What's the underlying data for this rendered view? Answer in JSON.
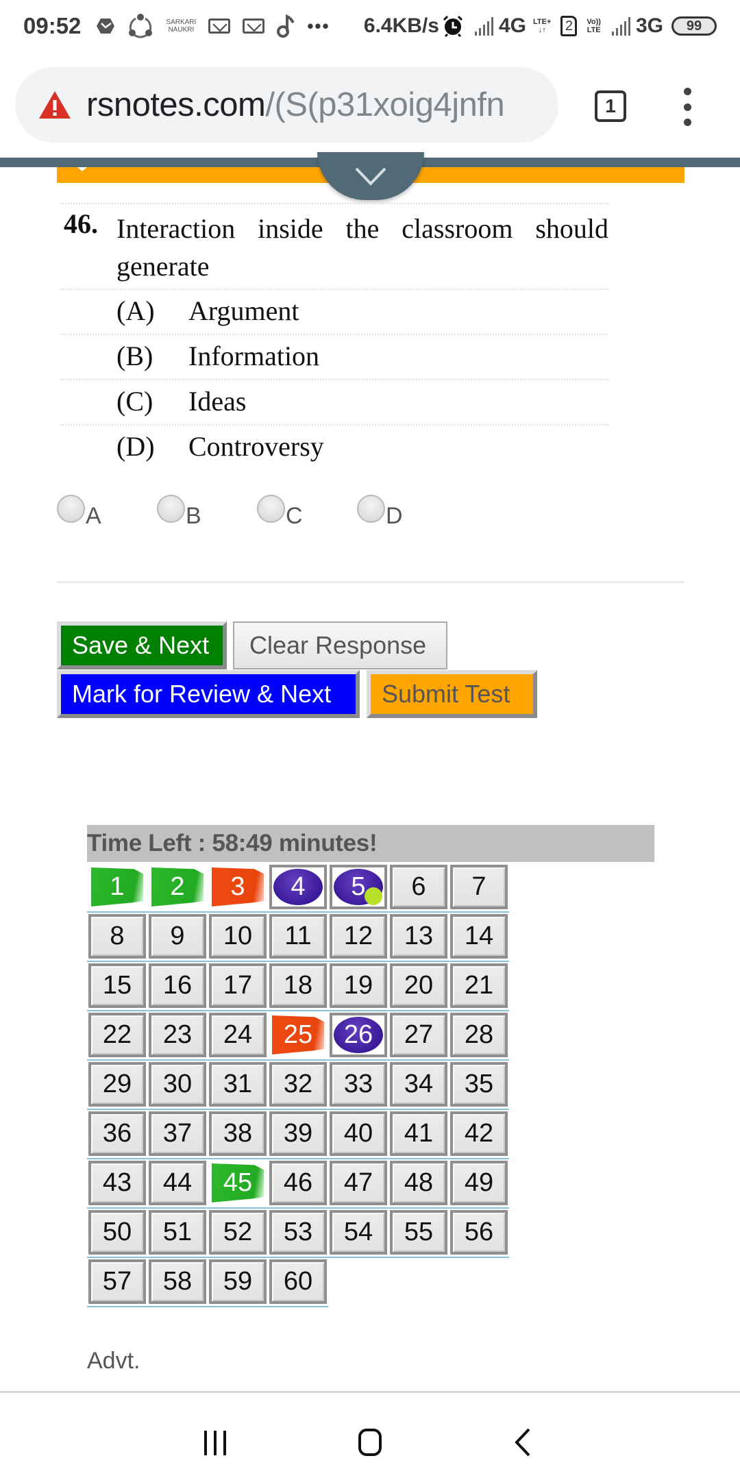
{
  "status_bar": {
    "time": "09:52",
    "notification_icons": [
      "box-app-icon",
      "shareit-icon",
      "sarkari-naukri-icon",
      "mail-icon",
      "mail-icon",
      "music-icon"
    ],
    "sarkari_line1": "SARKARI",
    "sarkari_line2": "NAUKRI",
    "more": "•••",
    "speed": "6.4KB/s",
    "network1": "4G",
    "lte_plus": "LTE+",
    "lte_arrows": "↓↑",
    "sim_number": "2",
    "volte_top": "Vo))",
    "volte_bottom": "LTE",
    "network2": "3G",
    "battery": "99"
  },
  "browser": {
    "url_domain": "rsnotes.com",
    "url_path": "/(S(p31xoig4jnfn",
    "tab_count": "1"
  },
  "question": {
    "number": "46.",
    "text_line1": "Interaction inside the classroom should",
    "text_line2": "generate",
    "options": [
      {
        "letter": "(A)",
        "text": "Argument"
      },
      {
        "letter": "(B)",
        "text": "Information"
      },
      {
        "letter": "(C)",
        "text": "Ideas"
      },
      {
        "letter": "(D)",
        "text": "Controversy"
      }
    ]
  },
  "answer_choices": [
    {
      "label": "A",
      "selected": false
    },
    {
      "label": "B",
      "selected": false
    },
    {
      "label": "C",
      "selected": false
    },
    {
      "label": "D",
      "selected": false
    }
  ],
  "buttons": {
    "save_next": "Save & Next",
    "clear_response": "Clear Response",
    "mark_review_next": "Mark for Review & Next",
    "submit_test": "Submit Test"
  },
  "colors": {
    "save": "#008000",
    "review": "#0000ff",
    "submit": "#ffa500",
    "answered": "#22aa22",
    "not_answered": "#e8450d",
    "marked": "#3b1a9a"
  },
  "timer": {
    "text": "Time Left : 58:49 minutes!"
  },
  "palette": [
    {
      "n": "1",
      "status": "answered"
    },
    {
      "n": "2",
      "status": "answered"
    },
    {
      "n": "3",
      "status": "notanswered"
    },
    {
      "n": "4",
      "status": "review"
    },
    {
      "n": "5",
      "status": "review-answered"
    },
    {
      "n": "6",
      "status": "notvisited"
    },
    {
      "n": "7",
      "status": "notvisited"
    },
    {
      "n": "8",
      "status": "notvisited"
    },
    {
      "n": "9",
      "status": "notvisited"
    },
    {
      "n": "10",
      "status": "notvisited"
    },
    {
      "n": "11",
      "status": "notvisited"
    },
    {
      "n": "12",
      "status": "notvisited"
    },
    {
      "n": "13",
      "status": "notvisited"
    },
    {
      "n": "14",
      "status": "notvisited"
    },
    {
      "n": "15",
      "status": "notvisited"
    },
    {
      "n": "16",
      "status": "notvisited"
    },
    {
      "n": "17",
      "status": "notvisited"
    },
    {
      "n": "18",
      "status": "notvisited"
    },
    {
      "n": "19",
      "status": "notvisited"
    },
    {
      "n": "20",
      "status": "notvisited"
    },
    {
      "n": "21",
      "status": "notvisited"
    },
    {
      "n": "22",
      "status": "notvisited"
    },
    {
      "n": "23",
      "status": "notvisited"
    },
    {
      "n": "24",
      "status": "notvisited"
    },
    {
      "n": "25",
      "status": "notanswered"
    },
    {
      "n": "26",
      "status": "review"
    },
    {
      "n": "27",
      "status": "notvisited"
    },
    {
      "n": "28",
      "status": "notvisited"
    },
    {
      "n": "29",
      "status": "notvisited"
    },
    {
      "n": "30",
      "status": "notvisited"
    },
    {
      "n": "31",
      "status": "notvisited"
    },
    {
      "n": "32",
      "status": "notvisited"
    },
    {
      "n": "33",
      "status": "notvisited"
    },
    {
      "n": "34",
      "status": "notvisited"
    },
    {
      "n": "35",
      "status": "notvisited"
    },
    {
      "n": "36",
      "status": "notvisited"
    },
    {
      "n": "37",
      "status": "notvisited"
    },
    {
      "n": "38",
      "status": "notvisited"
    },
    {
      "n": "39",
      "status": "notvisited"
    },
    {
      "n": "40",
      "status": "notvisited"
    },
    {
      "n": "41",
      "status": "notvisited"
    },
    {
      "n": "42",
      "status": "notvisited"
    },
    {
      "n": "43",
      "status": "notvisited"
    },
    {
      "n": "44",
      "status": "notvisited"
    },
    {
      "n": "45",
      "status": "answered"
    },
    {
      "n": "46",
      "status": "notvisited"
    },
    {
      "n": "47",
      "status": "notvisited"
    },
    {
      "n": "48",
      "status": "notvisited"
    },
    {
      "n": "49",
      "status": "notvisited"
    },
    {
      "n": "50",
      "status": "notvisited"
    },
    {
      "n": "51",
      "status": "notvisited"
    },
    {
      "n": "52",
      "status": "notvisited"
    },
    {
      "n": "53",
      "status": "notvisited"
    },
    {
      "n": "54",
      "status": "notvisited"
    },
    {
      "n": "55",
      "status": "notvisited"
    },
    {
      "n": "56",
      "status": "notvisited"
    },
    {
      "n": "57",
      "status": "notvisited"
    },
    {
      "n": "58",
      "status": "notvisited"
    },
    {
      "n": "59",
      "status": "notvisited"
    },
    {
      "n": "60",
      "status": "notvisited"
    }
  ],
  "advt_label": "Advt.",
  "nav": {
    "recents": "recents-icon",
    "home": "home-icon",
    "back": "back-icon"
  }
}
